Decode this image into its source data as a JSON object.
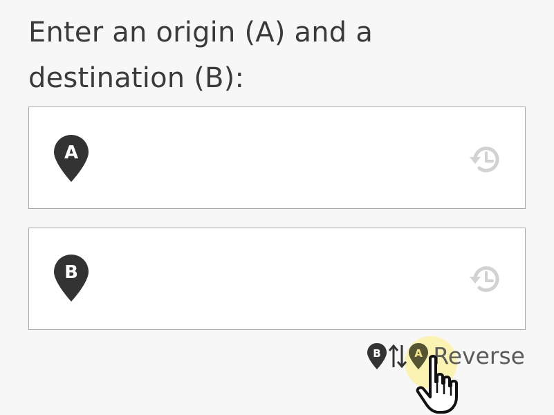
{
  "heading": "Enter an origin (A) and a destination (B):",
  "origin": {
    "marker_letter": "A",
    "value": "",
    "placeholder": ""
  },
  "destination": {
    "marker_letter": "B",
    "value": "",
    "placeholder": ""
  },
  "reverse": {
    "label": "Reverse",
    "icon_letter_b": "B",
    "icon_letter_a": "A"
  },
  "icons": {
    "marker": "map-pin-icon",
    "history": "history-icon",
    "swap": "swap-vertical-icon",
    "cursor": "hand-pointer-icon"
  },
  "colors": {
    "marker": "#333333",
    "history": "#d0d0d0",
    "highlight": "#f5e88a",
    "text": "#3a3a3a"
  }
}
